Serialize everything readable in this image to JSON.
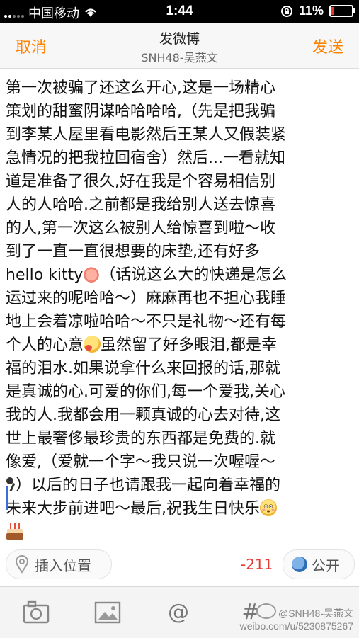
{
  "status_bar": {
    "carrier": "中国移动",
    "time": "1:44",
    "battery_percent": "11%",
    "battery_level": 0.11,
    "signal_bars_filled": 2
  },
  "nav": {
    "cancel_label": "取消",
    "title": "发微博",
    "subtitle": "SNH48-吴燕文",
    "send_label": "发送"
  },
  "body_lines": [
    "第一次被骗了还这么开心,这是一场精心",
    "策划的甜蜜阴谋哈哈哈哈,（先是把我骗",
    "到李某人屋里看电影然后王某人又假装紧",
    "急情况的把我拉回宿舍）然后...一看就知",
    "道是准备了很久,好在我是个容易相信别",
    "人的人哈哈.之前都是我给别人送去惊喜",
    "的人,第一次这么被别人给惊喜到啦～收",
    "到了一直一直很想要的床垫,还有好多"
  ],
  "line9_before": "hello kitty",
  "line9_after": "（话说这么大的快递是怎么",
  "line10": "运过来的呢哈哈～）麻麻再也不担心我睡",
  "line11": "地上会着凉啦哈哈～不只是礼物～还有每",
  "line12_before": "个人的心意",
  "line12_after": "虽然留了好多眼泪,都是幸",
  "line13": "福的泪水.如果说拿什么来回报的话,那就",
  "line14": "是真诚的心.可爱的你们,每一个爱我,关心",
  "line15": "我的人.我都会用一颗真诚的心去对待,这",
  "line16": "世上最奢侈最珍贵的东西都是免费的.就",
  "line17": "像爱,（爱就一个字～我只说一次喔喔～",
  "line18_after": "）以后的日子也请跟我一起向着幸福的",
  "line19_before": "未来大步前进吧～最后,祝我生日快乐",
  "location_label": "插入位置",
  "char_count": "-211",
  "visibility_label": "公开",
  "watermark": {
    "line1": "@SNH48-吴燕文",
    "line2": "weibo.com/u/5230875267"
  },
  "icons": [
    "camera-icon",
    "image-icon",
    "at-icon",
    "hashtag-icon",
    "location-pin-icon",
    "globe-icon"
  ],
  "colors": {
    "accent": "#ff8200",
    "count": "#e53935",
    "cursor": "#3b6fd8"
  }
}
